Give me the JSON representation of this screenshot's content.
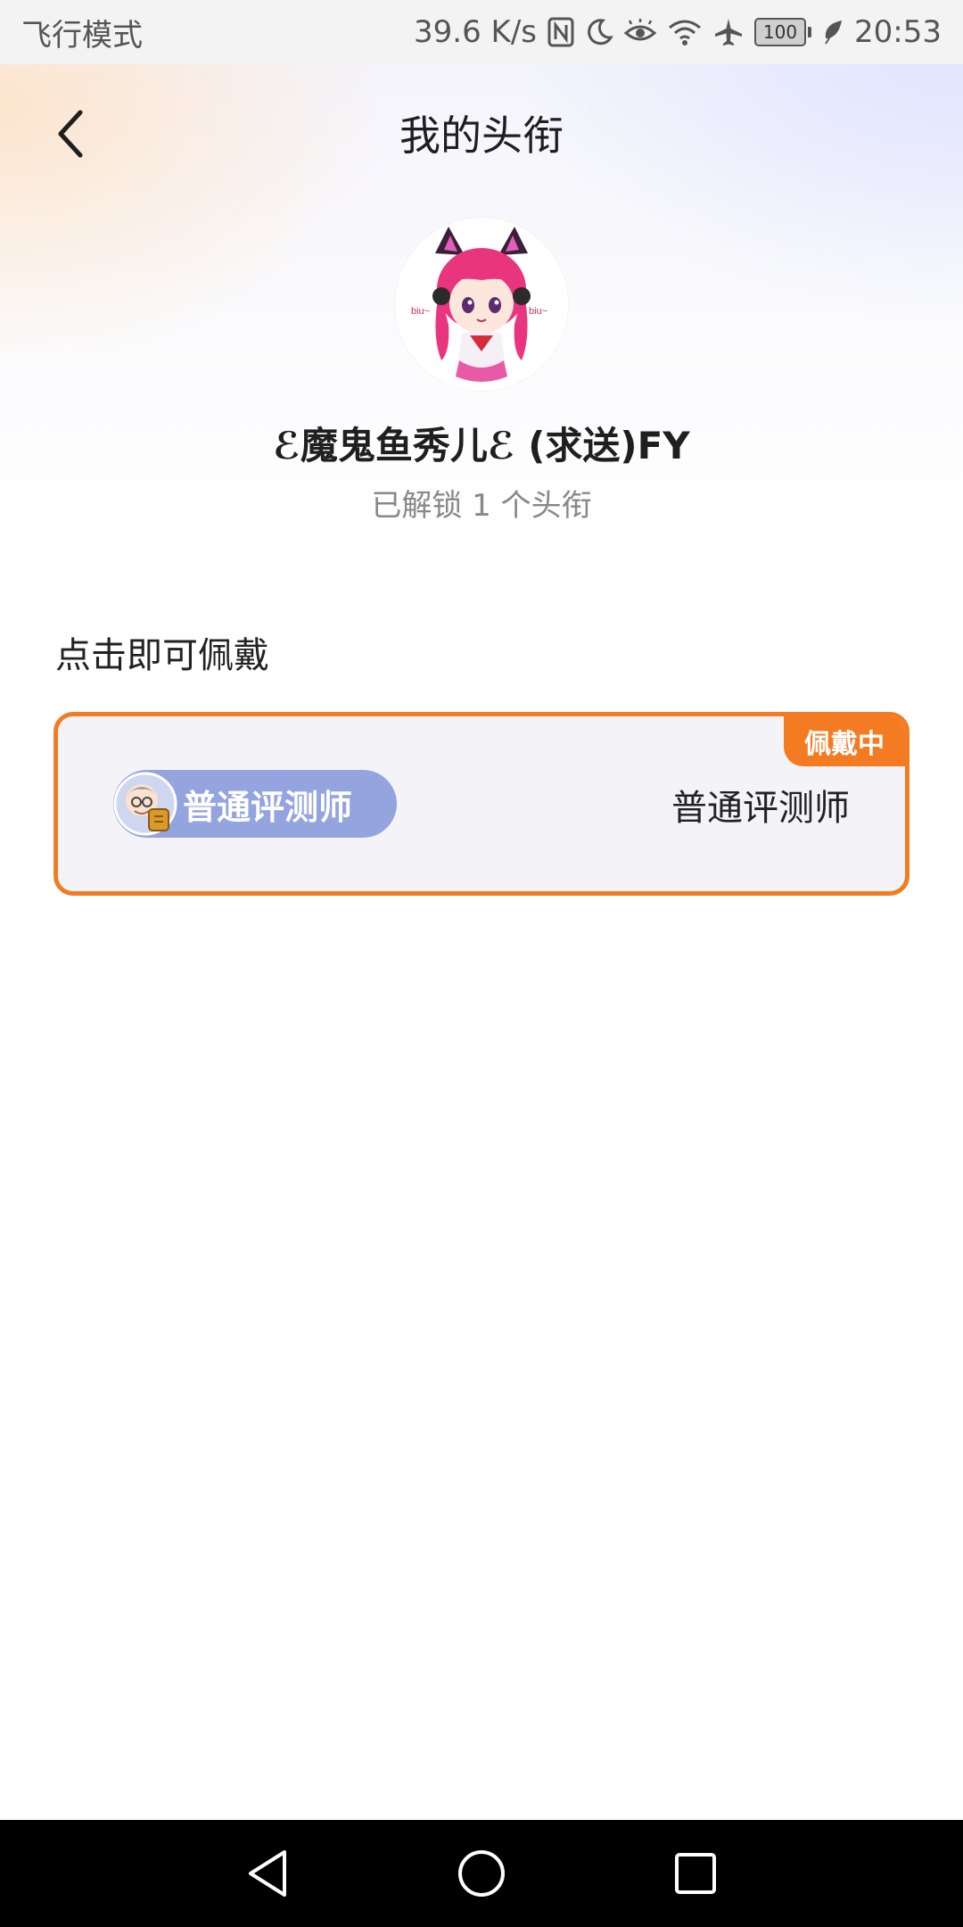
{
  "status_bar": {
    "left_text": "飞行模式",
    "network_speed": "39.6 K/s",
    "battery_level": "100",
    "time": "20:53",
    "icons": [
      "nfc-icon",
      "moon-icon",
      "eye-icon",
      "wifi-icon",
      "airplane-icon",
      "battery-icon",
      "leaf-icon"
    ]
  },
  "header": {
    "title": "我的头衔",
    "back_icon": "chevron-left-icon"
  },
  "profile": {
    "username": "ℰ魔鬼鱼秀儿ℰ (求送)FY",
    "unlock_text": "已解锁 1 个头衔"
  },
  "section": {
    "label": "点击即可佩戴"
  },
  "titles": [
    {
      "tag_label": "普通评测师",
      "name": "普通评测师",
      "badge": "佩戴中",
      "tag_color": "#93a4de",
      "border_color": "#f07d24"
    }
  ],
  "system_nav": {
    "icons": [
      "back-triangle-icon",
      "home-circle-icon",
      "recents-square-icon"
    ]
  },
  "colors": {
    "accent": "#f47b22",
    "tag_bg": "#93a4de",
    "nav_bg": "#000000"
  }
}
